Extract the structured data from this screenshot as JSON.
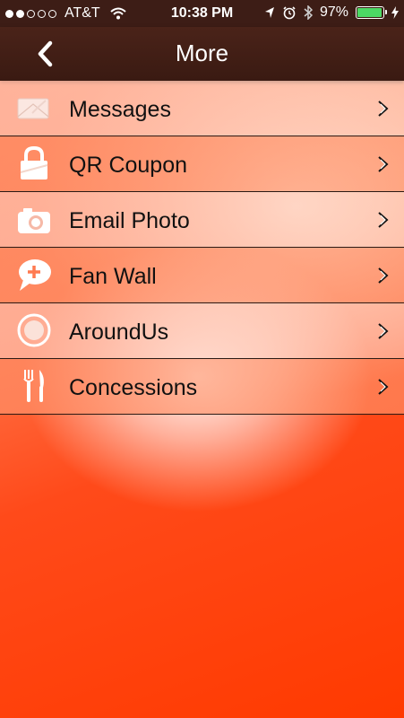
{
  "status_bar": {
    "carrier": "AT&T",
    "time": "10:38 PM",
    "battery_percent": "97%",
    "battery_level": 0.97,
    "signal_bars": 2,
    "signal_total": 5
  },
  "nav": {
    "title": "More",
    "back_icon": "chevron-left-icon"
  },
  "menu": {
    "items": [
      {
        "label": "Messages",
        "icon": "envelope-icon"
      },
      {
        "label": "QR Coupon",
        "icon": "lock-icon"
      },
      {
        "label": "Email Photo",
        "icon": "camera-icon"
      },
      {
        "label": "Fan Wall",
        "icon": "speech-bubble-plus-icon"
      },
      {
        "label": "AroundUs",
        "icon": "compass-icon"
      },
      {
        "label": "Concessions",
        "icon": "fork-knife-icon"
      }
    ]
  },
  "colors": {
    "nav_bg": "#3a1a12",
    "accent_orange": "#ff3a00",
    "row_divider": "#2b1a14"
  }
}
